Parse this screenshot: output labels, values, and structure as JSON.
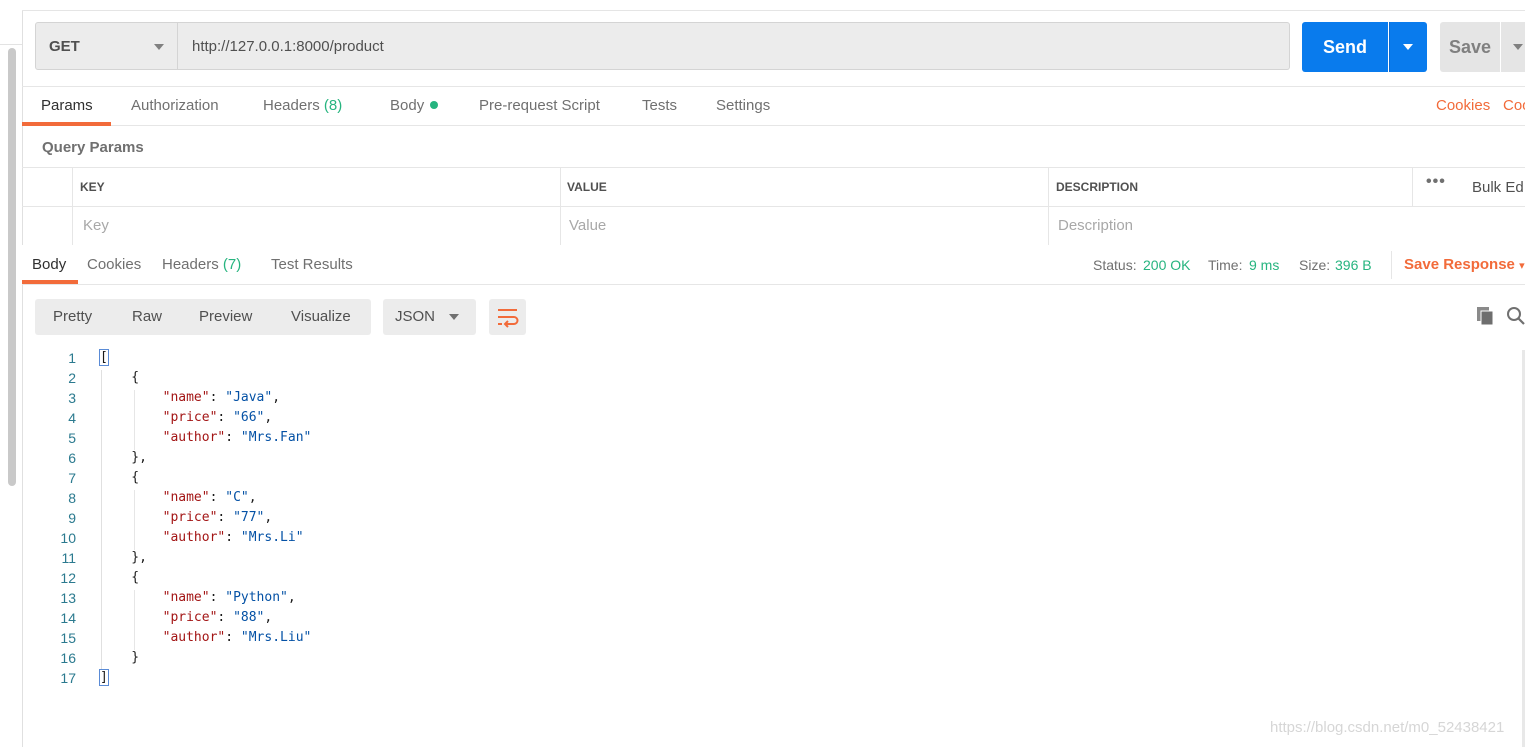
{
  "request": {
    "method": "GET",
    "url": "http://127.0.0.1:8000/product",
    "send_label": "Send",
    "save_label": "Save"
  },
  "request_tabs": {
    "params": "Params",
    "authorization": "Authorization",
    "headers": "Headers",
    "headers_count": "(8)",
    "body": "Body",
    "prerequest": "Pre-request Script",
    "tests": "Tests",
    "settings": "Settings",
    "cookies": "Cookies",
    "code_partial": "Coo"
  },
  "query_params": {
    "title": "Query Params",
    "columns": [
      "KEY",
      "VALUE",
      "DESCRIPTION"
    ],
    "bulk_edit": "Bulk Ed",
    "placeholders": {
      "key": "Key",
      "value": "Value",
      "description": "Description"
    }
  },
  "response": {
    "tabs": {
      "body": "Body",
      "cookies": "Cookies",
      "headers": "Headers",
      "headers_count": "(7)",
      "test_results": "Test Results"
    },
    "status_label": "Status:",
    "status_value": "200 OK",
    "time_label": "Time:",
    "time_value": "9 ms",
    "size_label": "Size:",
    "size_value": "396 B",
    "save_response": "Save Response",
    "views": [
      "Pretty",
      "Raw",
      "Preview",
      "Visualize"
    ],
    "format": "JSON"
  },
  "code_lines": [
    {
      "n": "1",
      "t": "["
    },
    {
      "n": "2",
      "t": "    {"
    },
    {
      "n": "3",
      "k": "\"name\"",
      "v": "\"Java\"",
      "c": ","
    },
    {
      "n": "4",
      "k": "\"price\"",
      "v": "\"66\"",
      "c": ","
    },
    {
      "n": "5",
      "k": "\"author\"",
      "v": "\"Mrs.Fan\"",
      "c": ""
    },
    {
      "n": "6",
      "t": "    },"
    },
    {
      "n": "7",
      "t": "    {"
    },
    {
      "n": "8",
      "k": "\"name\"",
      "v": "\"C\"",
      "c": ","
    },
    {
      "n": "9",
      "k": "\"price\"",
      "v": "\"77\"",
      "c": ","
    },
    {
      "n": "10",
      "k": "\"author\"",
      "v": "\"Mrs.Li\"",
      "c": ""
    },
    {
      "n": "11",
      "t": "    },"
    },
    {
      "n": "12",
      "t": "    {"
    },
    {
      "n": "13",
      "k": "\"name\"",
      "v": "\"Python\"",
      "c": ","
    },
    {
      "n": "14",
      "k": "\"price\"",
      "v": "\"88\"",
      "c": ","
    },
    {
      "n": "15",
      "k": "\"author\"",
      "v": "\"Mrs.Liu\"",
      "c": ""
    },
    {
      "n": "16",
      "t": "    }"
    },
    {
      "n": "17",
      "t": "]"
    }
  ],
  "watermark": "https://blog.csdn.net/m0_52438421",
  "colors": {
    "accent_orange": "#f26b3a",
    "send_blue": "#097bed",
    "success_green": "#26b47f",
    "json_key": "#a31515",
    "json_string": "#0451a5"
  },
  "icons": [
    "caret-down-icon",
    "wrap-lines-icon",
    "copy-icon",
    "search-icon",
    "more-dots-icon"
  ]
}
